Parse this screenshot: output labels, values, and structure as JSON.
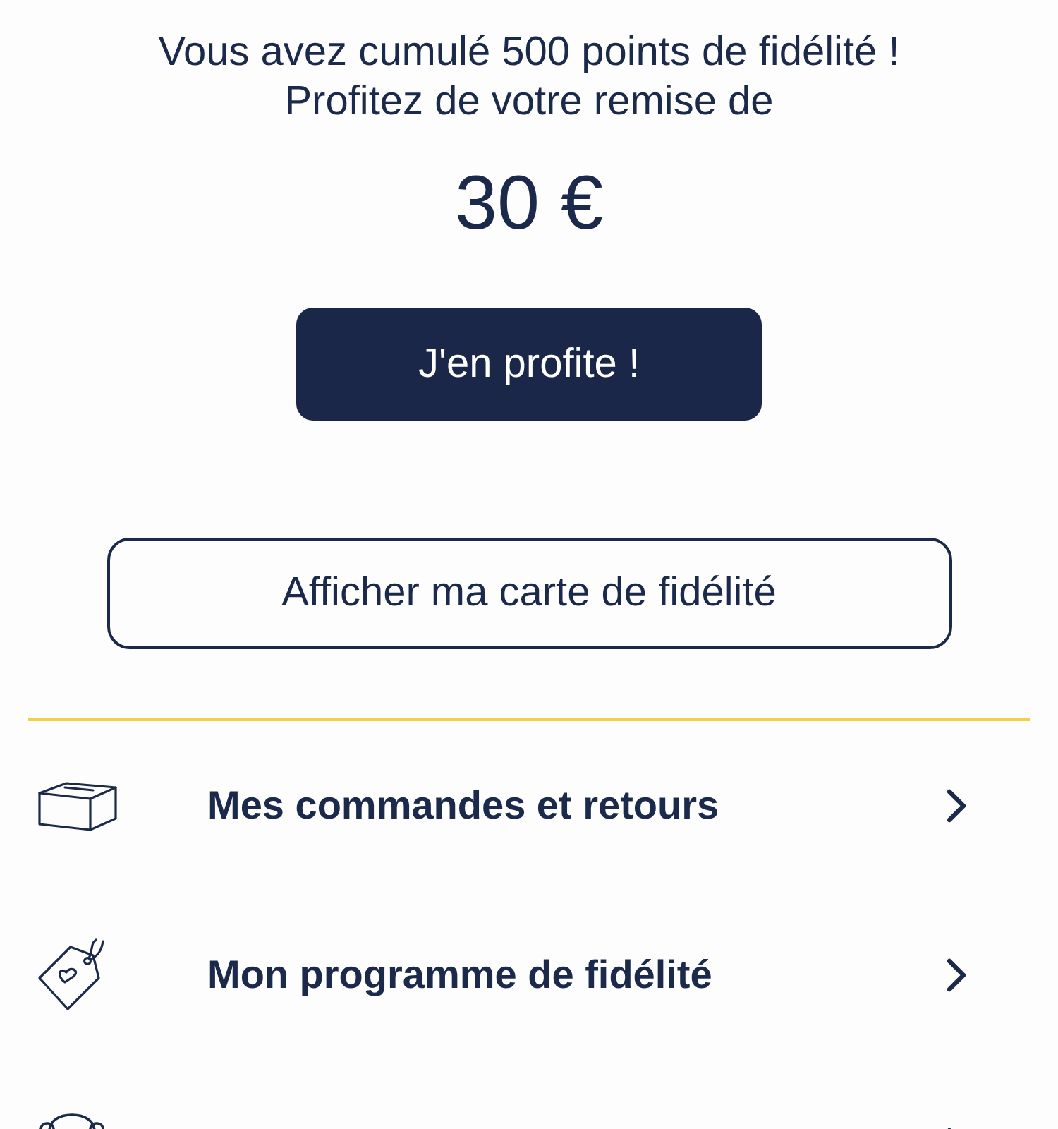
{
  "loyalty": {
    "points_message": "Vous avez cumulé 500 points de fidélité !",
    "discount_intro": "Profitez de votre remise de",
    "amount": "30 €",
    "claim_button": "J'en profite !",
    "card_button": "Afficher ma carte de fidélité"
  },
  "menu": [
    {
      "kind": "box",
      "label": "Mes commandes et retours"
    },
    {
      "kind": "tag",
      "label": "Mon programme de fidélité"
    },
    {
      "kind": "headset"
    }
  ]
}
